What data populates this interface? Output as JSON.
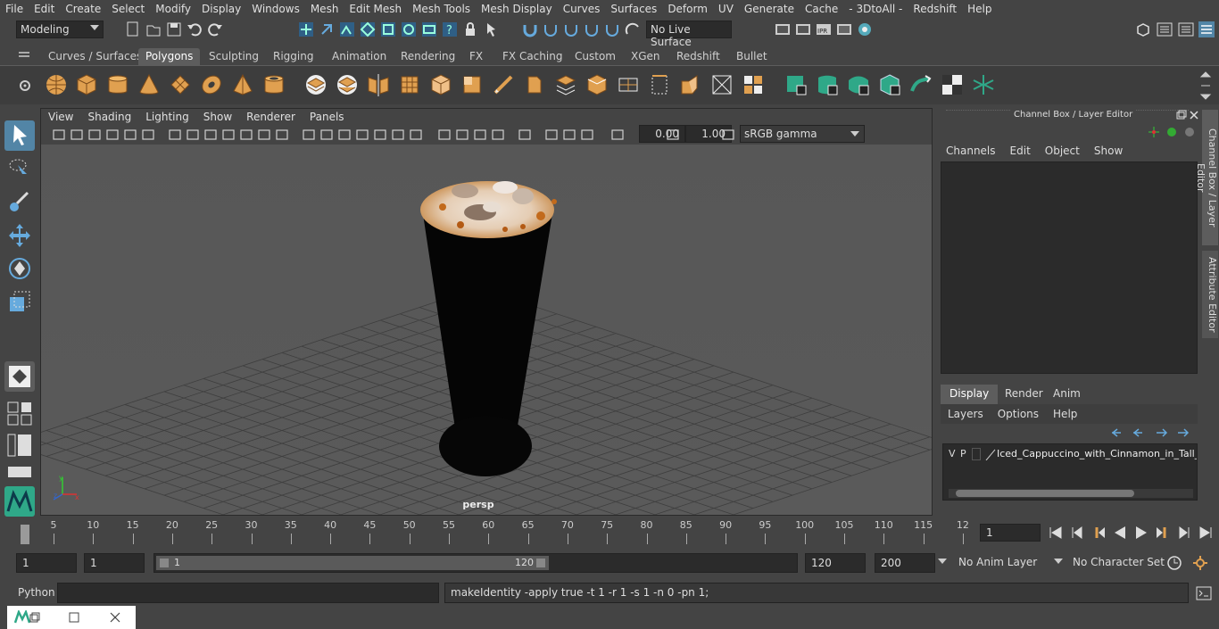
{
  "menu": [
    "File",
    "Edit",
    "Create",
    "Select",
    "Modify",
    "Display",
    "Windows",
    "Mesh",
    "Edit Mesh",
    "Mesh Tools",
    "Mesh Display",
    "Curves",
    "Surfaces",
    "Deform",
    "UV",
    "Generate",
    "Cache",
    "- 3DtoAll -",
    "Redshift",
    "Help"
  ],
  "status": {
    "mode": "Modeling",
    "live_surface": "No Live Surface"
  },
  "shelf_tabs": [
    "Curves / Surfaces",
    "Polygons",
    "Sculpting",
    "Rigging",
    "Animation",
    "Rendering",
    "FX",
    "FX Caching",
    "Custom",
    "XGen",
    "Redshift",
    "Bullet"
  ],
  "shelf_active": "Polygons",
  "viewport": {
    "menu": [
      "View",
      "Shading",
      "Lighting",
      "Show",
      "Renderer",
      "Panels"
    ],
    "exposure": "0.00",
    "gamma": "1.00",
    "color_space": "sRGB gamma",
    "camera_label": "persp"
  },
  "channel_box": {
    "title": "Channel Box / Layer Editor",
    "menu": [
      "Channels",
      "Edit",
      "Object",
      "Show"
    ],
    "layer_tabs": [
      "Display",
      "Render",
      "Anim"
    ],
    "layer_menu": [
      "Layers",
      "Options",
      "Help"
    ],
    "layer_row": {
      "v": "V",
      "p": "P",
      "name": "Iced_Cappuccino_with_Cinnamon_in_Tall_G"
    }
  },
  "side_tabs": [
    "Channel Box / Layer Editor",
    "Attribute Editor"
  ],
  "timeline": {
    "ticks": [
      "5",
      "10",
      "15",
      "20",
      "25",
      "30",
      "35",
      "40",
      "45",
      "50",
      "55",
      "60",
      "65",
      "70",
      "75",
      "80",
      "85",
      "90",
      "95",
      "100",
      "105",
      "110",
      "115",
      "12"
    ],
    "start_marker": "1",
    "current_frame": "1"
  },
  "range": {
    "start": "1",
    "anim_start": "1",
    "slider_start": "1",
    "slider_end": "120",
    "end": "120",
    "anim_end": "200",
    "anim_layer": "No Anim Layer",
    "char_set": "No Character Set"
  },
  "cmd": {
    "lang": "Python",
    "result": "makeIdentity -apply true -t 1 -r 1 -s 1 -n 0 -pn 1;"
  },
  "colors": {
    "accent": "#5285a6",
    "shelf_icon": "#e0a050",
    "shelf_green": "#2fa888",
    "bg": "#444444"
  }
}
